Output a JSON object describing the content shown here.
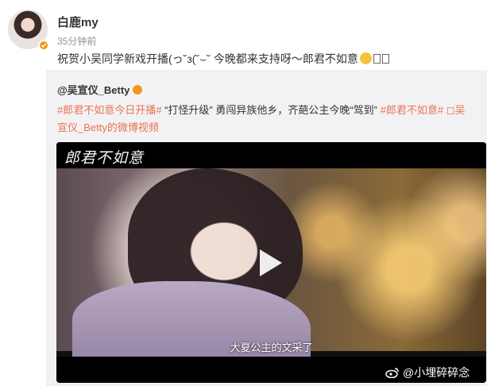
{
  "post": {
    "username": "白鹿my",
    "timestamp": "35分钟前",
    "text": "祝贺小吴同学新戏开播(っ˘з(˘⌣˘ 今晚都来支持呀～郎君不如意"
  },
  "repost": {
    "author": "@吴宣仪_Betty",
    "text_parts": {
      "tag1": "#郎君不如意今日开播#",
      "body1": " “打怪升级” 勇闯异族他乡，齐葩公主今晚“驾到” ",
      "tag2": "#郎君不如意#",
      "link": " ◻吴宣仪_Betty的微博视频"
    }
  },
  "video": {
    "title_art": "郎君不如意",
    "subtitle": "大夏公主的文采了"
  },
  "watermark": "@小埋碎碎念",
  "colors": {
    "accent": "#eb7350",
    "verified": "#f7941d",
    "repost_bg": "#f2f2f5"
  }
}
